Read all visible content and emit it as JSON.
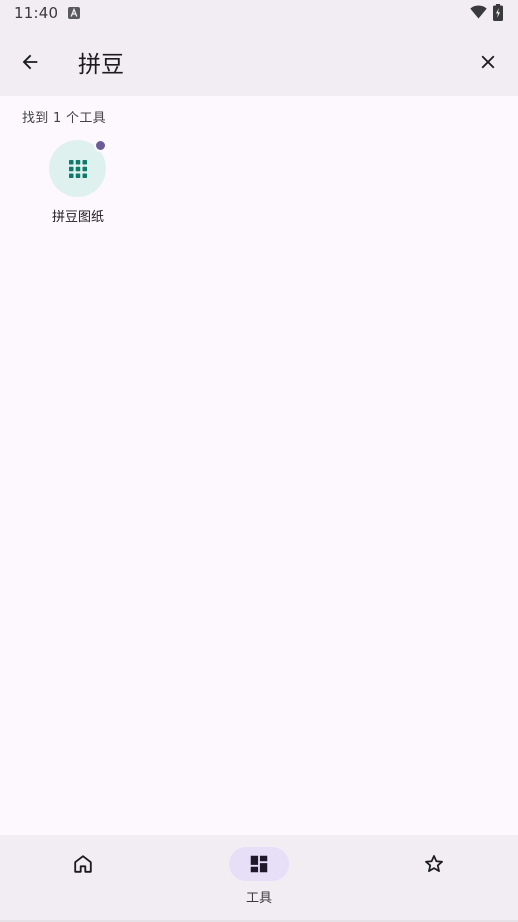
{
  "status_bar": {
    "time": "11:40"
  },
  "app_bar": {
    "back_icon": "arrow-back-icon",
    "search_query": "拼豆",
    "clear_icon": "close-icon"
  },
  "results": {
    "count_text": "找到 1 个工具",
    "items": [
      {
        "label": "拼豆图纸",
        "icon": "grid-dots-icon",
        "icon_color": "#0f7a6c",
        "icon_bg": "#dff1ef",
        "badge_color": "#6a5c99"
      }
    ]
  },
  "bottom_nav": {
    "items": [
      {
        "icon": "home-icon",
        "label": "",
        "active": false
      },
      {
        "icon": "dashboard-icon",
        "label": "工具",
        "active": true
      },
      {
        "icon": "star-icon",
        "label": "",
        "active": false
      }
    ]
  },
  "colors": {
    "background": "#fcf8fd",
    "bar": "#f1edf2",
    "active_pill": "#e7def7",
    "accent": "#6a5c99"
  }
}
